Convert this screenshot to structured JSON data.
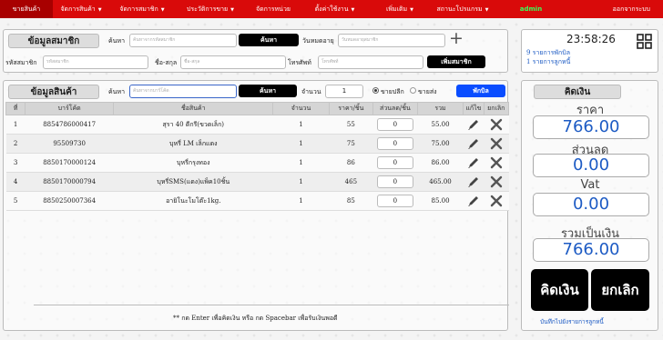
{
  "nav": {
    "items": [
      {
        "label": "ขายสินค้า",
        "caret": false,
        "active": true
      },
      {
        "label": "จัดการสินค้า",
        "caret": true,
        "active": false
      },
      {
        "label": "จัดการสมาชิก",
        "caret": true,
        "active": false
      },
      {
        "label": "ประวัติการขาย",
        "caret": true,
        "active": false
      },
      {
        "label": "จัดการหน่วย",
        "caret": false,
        "active": false
      },
      {
        "label": "ตั้งค่าใช้งาน",
        "caret": true,
        "active": false
      },
      {
        "label": "เพิ่มเติม",
        "caret": true,
        "active": false
      },
      {
        "label": "สถานะโปรแกรม",
        "caret": true,
        "active": false
      }
    ],
    "admin": "admin",
    "logout": "ออกจากระบบ"
  },
  "member": {
    "title": "ข้อมูลสมาชิก",
    "search_label": "ค้นหา",
    "search_placeholder": "ค้นหาจากรหัสสมาชิก",
    "search_button": "ค้นหา",
    "expire_label": "วันหมดอายุ",
    "expire_placeholder": "วันหมดอายุสมาชิก",
    "plus": "+",
    "code_label": "รหัสสมาชิก",
    "code_placeholder": "รหัสสมาชิก",
    "name_label": "ชื่อ-สกุล",
    "name_placeholder": "ชื่อ-สกุล",
    "phone_label": "โทรศัพท์",
    "phone_placeholder": "โทรศัพท์",
    "add_button": "เพิ่มสมาชิก"
  },
  "status": {
    "time": "23:58:26",
    "line1": "9 รายการพักบิล",
    "line2": "1 รายการลูกหนี้"
  },
  "product": {
    "title": "ข้อมูลสินค้า",
    "search_label": "ค้นหา",
    "search_placeholder": "ค้นหาจากบาร์โค้ด",
    "search_button": "ค้นหา",
    "qty_label": "จำนวน",
    "qty_value": "1",
    "retail": "ขายปลีก",
    "wholesale": "ขายส่ง",
    "hold_button": "พักบิล"
  },
  "table": {
    "headers": [
      "ที่",
      "บาร์โค้ด",
      "ชื่อสินค้า",
      "จำนวน",
      "ราคา/ชิ้น",
      "ส่วนลด/ชิ้น",
      "รวม",
      "แก้ไข",
      "ยกเลิก"
    ],
    "rows": [
      {
        "no": "1",
        "barcode": "8854786000417",
        "name": "สุรา 40 ดีกรี(ขวดเล็ก)",
        "qty": "1",
        "price": "55",
        "discount": "0",
        "total": "55.00"
      },
      {
        "no": "2",
        "barcode": "95509730",
        "name": "บุหรี่ LM เล็กแดง",
        "qty": "1",
        "price": "75",
        "discount": "0",
        "total": "75.00"
      },
      {
        "no": "3",
        "barcode": "8850170000124",
        "name": "บุหรี่กรุงทอง",
        "qty": "1",
        "price": "86",
        "discount": "0",
        "total": "86.00"
      },
      {
        "no": "4",
        "barcode": "8850170000794",
        "name": "บุหรี่SMS(แดง)แพ็ค10ชิ้น",
        "qty": "1",
        "price": "465",
        "discount": "0",
        "total": "465.00"
      },
      {
        "no": "5",
        "barcode": "8850250007364",
        "name": "อายิโนะโมโต๊ะ1kg.",
        "qty": "1",
        "price": "85",
        "discount": "0",
        "total": "85.00"
      }
    ]
  },
  "footer_note": "** กด Enter เพื่อคิดเงิน หรือ กด Spacebar เพื่อรับเงินพอดี",
  "summary": {
    "title": "คิดเงิน",
    "price_label": "ราคา",
    "price": "766.00",
    "discount_label": "ส่วนลด",
    "discount": "0.00",
    "vat_label": "Vat",
    "vat": "0.00",
    "total_label": "รวมเป็นเงิน",
    "total": "766.00",
    "pay_button": "คิดเงิน",
    "cancel_button": "ยกเลิก",
    "debt_link": "บันทึกไปยังรายการลูกหนี้"
  },
  "colors": {
    "nav": "#d90a0a",
    "accent": "#1d5bc4",
    "hold": "#0a4dff",
    "admin": "#39ff5a"
  }
}
